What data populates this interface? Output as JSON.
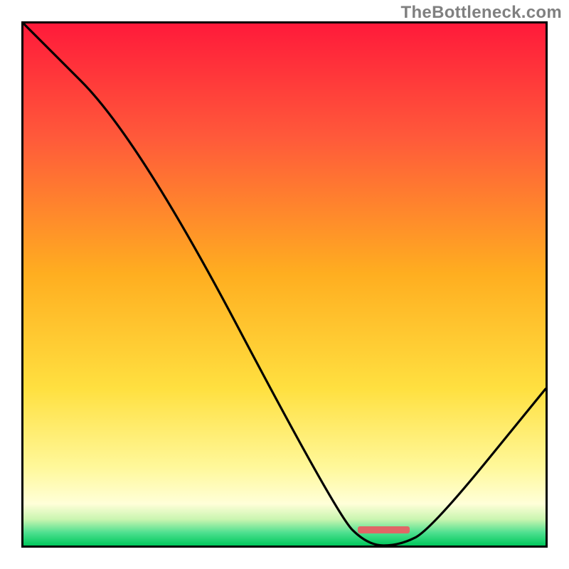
{
  "watermark": "TheBottleneck.com",
  "colors": {
    "border": "#000000",
    "watermark_text": "#808080",
    "gradient_top": "#ff1a3a",
    "gradient_upper": "#ff6a2a",
    "gradient_mid": "#ffc800",
    "gradient_lower": "#fff060",
    "gradient_pale": "#ffffc0",
    "gradient_green": "#00d060",
    "curve": "#000000",
    "tick": "#dd7777"
  },
  "chart_data": {
    "type": "line",
    "title": "",
    "xlabel": "",
    "ylabel": "",
    "xlim": [
      0,
      100
    ],
    "ylim": [
      0,
      100
    ],
    "x": [
      0,
      22,
      60,
      66,
      72,
      78,
      100
    ],
    "y": [
      100,
      78,
      6,
      0,
      0,
      3,
      30
    ],
    "minimum_band": {
      "x_start": 64,
      "x_end": 74
    },
    "notes": "V-shaped bottleneck curve over a red-to-green vertical gradient. Minimum (≈0) around x≈66–72; curve rises back to ≈30 at x=100. Small red tick marks the optimal band on the x-axis near x≈64–74."
  }
}
